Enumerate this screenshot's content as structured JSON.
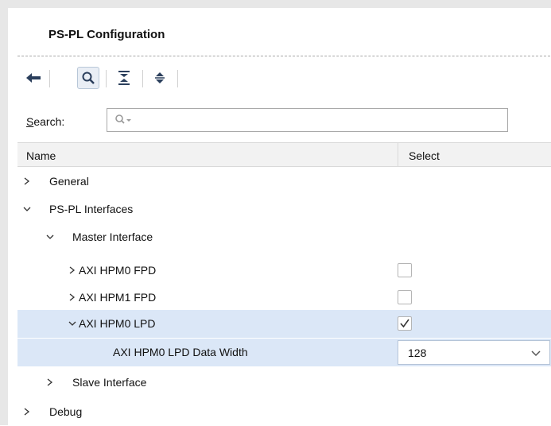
{
  "panel": {
    "title": "PS-PL Configuration"
  },
  "toolbar": {
    "buttons": [
      {
        "icon": "back-arrow-icon"
      },
      {
        "icon": "search-icon",
        "active": true
      },
      {
        "icon": "collapse-all-icon"
      },
      {
        "icon": "expand-all-icon"
      }
    ]
  },
  "search": {
    "label_prefix": "S",
    "label_rest": "earch:",
    "value": ""
  },
  "table": {
    "headers": {
      "name": "Name",
      "select": "Select"
    },
    "rows": [
      {
        "label": "General",
        "expanded": false
      },
      {
        "label": "PS-PL Interfaces",
        "expanded": true
      },
      {
        "label": "Master Interface",
        "expanded": true
      },
      {
        "label": "AXI HPM0 FPD",
        "expanded": false,
        "checked": false
      },
      {
        "label": "AXI HPM1 FPD",
        "expanded": false,
        "checked": false
      },
      {
        "label": "AXI HPM0 LPD",
        "expanded": true,
        "checked": true,
        "highlighted": true
      },
      {
        "label": "AXI HPM0 LPD Data Width",
        "value": "128",
        "highlighted": true
      },
      {
        "label": "Slave Interface",
        "expanded": false
      },
      {
        "label": "Debug",
        "expanded": false
      }
    ]
  },
  "colors": {
    "highlight": "#dbe7f7",
    "header_bg": "#f2f2f2"
  }
}
